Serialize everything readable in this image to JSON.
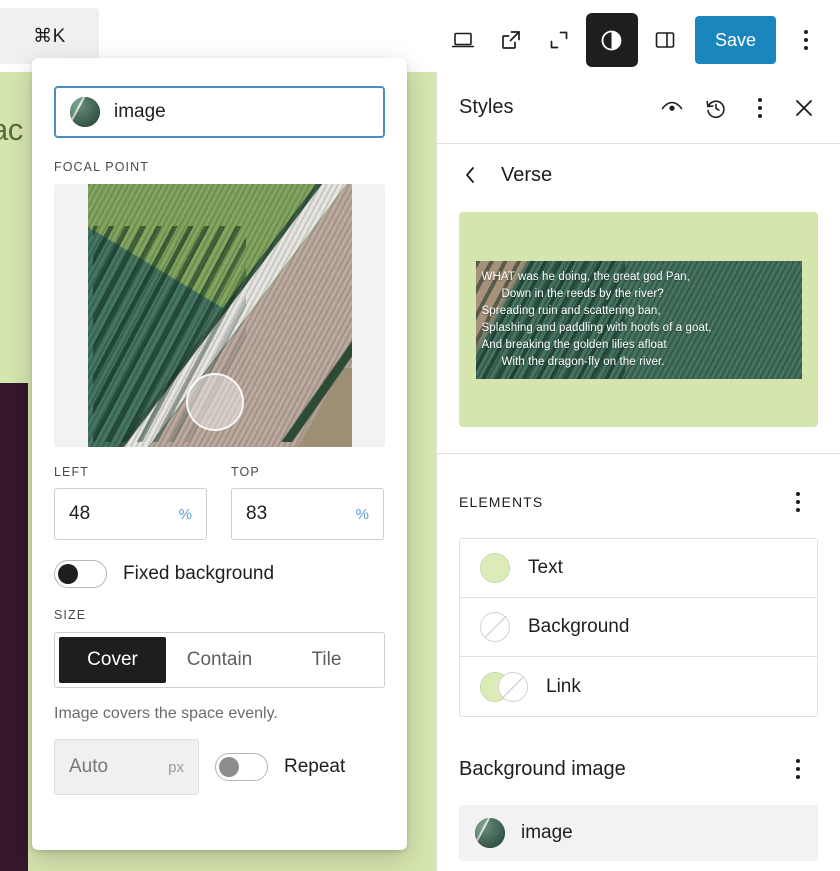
{
  "toolbar": {
    "command_shortcut": "⌘K",
    "icons": [
      {
        "name": "device-preview-icon",
        "title": "View"
      },
      {
        "name": "external-link-icon",
        "title": "View site"
      },
      {
        "name": "zen-mode-icon",
        "title": "Distraction free"
      },
      {
        "name": "styles-contrast-icon",
        "title": "Styles"
      },
      {
        "name": "sidebar-toggle-icon",
        "title": "Settings"
      }
    ],
    "save_label": "Save",
    "more_label": "Options"
  },
  "canvas": {
    "clipped_text": "vac",
    "green_color": "#d5e5ae",
    "dark_color": "#36172b"
  },
  "popover": {
    "media": {
      "label": "image",
      "thumbnail_name": "image-thumbnail"
    },
    "focal_point": {
      "section_label": "Focal point",
      "left_label": "Left",
      "left_value": "48",
      "left_unit": "%",
      "top_label": "Top",
      "top_value": "83",
      "top_unit": "%"
    },
    "fixed_background": {
      "label": "Fixed background",
      "enabled": false
    },
    "size": {
      "section_label": "Size",
      "options": [
        "Cover",
        "Contain",
        "Tile"
      ],
      "selected": "Cover",
      "helper_text": "Image covers the space evenly.",
      "custom_placeholder": "Auto",
      "custom_unit": "px",
      "repeat_label": "Repeat",
      "repeat_enabled": false
    }
  },
  "sidebar": {
    "title": "Styles",
    "header_icons": [
      {
        "name": "eye-icon",
        "title": "Style book"
      },
      {
        "name": "revisions-icon",
        "title": "Revisions"
      },
      {
        "name": "more-options-icon",
        "title": "More"
      },
      {
        "name": "close-icon",
        "title": "Close"
      }
    ],
    "breadcrumb": {
      "back_label": "Back",
      "title": "Verse"
    },
    "preview": {
      "lines": [
        "WHAT was he doing, the great god Pan,",
        "Down in the reeds by the river?",
        "Spreading ruin and scattering ban,",
        "Splashing and paddling with hoofs of a goat,",
        "And breaking the golden lilies afloat",
        "With the dragon-fly on the river."
      ],
      "indented": [
        false,
        true,
        false,
        false,
        false,
        true
      ],
      "card_bg": "#d5e5ae"
    },
    "elements": {
      "section_label": "Elements",
      "more_label": "More",
      "items": [
        {
          "label": "Text",
          "swatch": "filled",
          "color": "#dcecb9"
        },
        {
          "label": "Background",
          "swatch": "none",
          "color": "#ffffff"
        },
        {
          "label": "Link",
          "swatch": "duo",
          "color": "#dcecb9"
        }
      ]
    },
    "background_image": {
      "section_label": "Background image",
      "more_label": "More",
      "item_label": "image"
    }
  }
}
